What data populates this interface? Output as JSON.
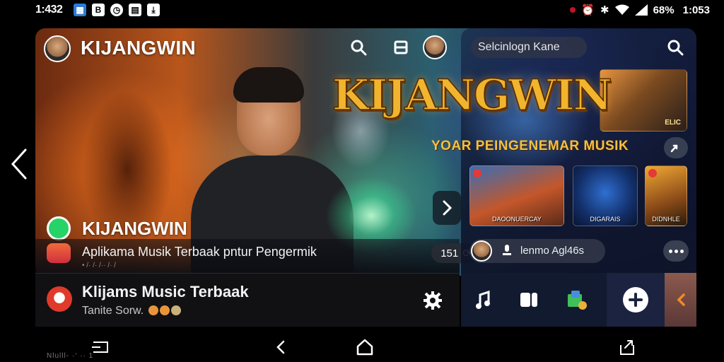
{
  "status_bar": {
    "time_left": "1:432",
    "battery": "68%",
    "time_right": "1:053",
    "icons_left": [
      "blue-app-icon",
      "b-icon",
      "clock-icon",
      "news-icon",
      "download-icon"
    ],
    "icons_right": [
      "record-dot-icon",
      "alarm-icon",
      "bluetooth-icon",
      "wifi-icon",
      "signal-icon"
    ]
  },
  "header": {
    "title": "KIJANGWIN"
  },
  "featured": {
    "row1_title": "KIJANGWIN",
    "row2_text": "Aplikama Musik Terbaak pntur Pengermik",
    "row2_count": "151",
    "row2_sub": "• /· /· /·· /· /"
  },
  "list_item": {
    "title": "Klijams Music Terbaak",
    "subtitle": "Tanite Sorw."
  },
  "right_panel": {
    "search_placeholder": "Selcinlogn Kane",
    "logo": "KIJANGWIN",
    "tagline": "YOAR PEINGENEMAR MUSIK",
    "hero_caption": "ELIC",
    "thumbs": [
      {
        "caption": "DAOONUERCAY"
      },
      {
        "caption": "DIGARAIS"
      },
      {
        "caption": "DIDNHLE"
      }
    ],
    "user_pill_text": "lenmo Agl46s"
  },
  "navbar": {
    "watermark": "Nlulll- ·‘ ·· 1"
  },
  "colors": {
    "accent_gold": "#f1b42e",
    "whatsapp_green": "#25d366",
    "dock_bg": "#121a30",
    "orange_arrow": "#f08a2a"
  }
}
